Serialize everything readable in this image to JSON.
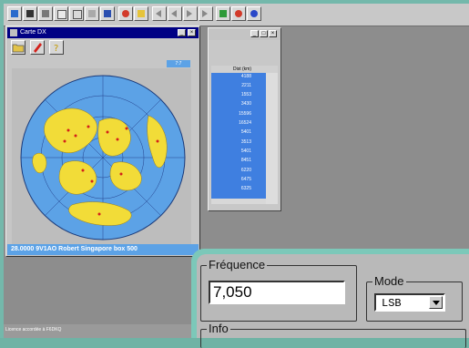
{
  "carte_window": {
    "title": "Carte DX",
    "zoom": "7:7",
    "status": "28.0000 9V1AO Robert Singapore  box 500"
  },
  "list_window": {
    "column_header": "Dist (km)",
    "distances": [
      "4188",
      "2211",
      "1553",
      "3430",
      "15596",
      "16524",
      "5401",
      "3513",
      "5401",
      "8451",
      "6220",
      "6475",
      "6325"
    ]
  },
  "license_text": "Licence accordée à F6DKQ",
  "frequency_panel": {
    "freq_label": "Fréquence",
    "freq_value": "7,050",
    "mode_label": "Mode",
    "mode_value": "LSB",
    "info_label": "Info"
  },
  "colors": {
    "ocean": "#5ca2e6",
    "land": "#f2dc38",
    "selection": "#3f7fe0",
    "titlebar": "#000084",
    "panel_frame": "#7cc8b9"
  },
  "toolbar_icons": [
    "file-icon",
    "save-icon",
    "print-icon",
    "copy-icon",
    "paste-icon",
    "list-icon",
    "doc-icon",
    "globe-icon",
    "help-icon",
    "nav-first-icon",
    "nav-prev-icon",
    "nav-next-icon",
    "nav-last-icon",
    "flag-icon",
    "target-icon",
    "info-icon"
  ]
}
